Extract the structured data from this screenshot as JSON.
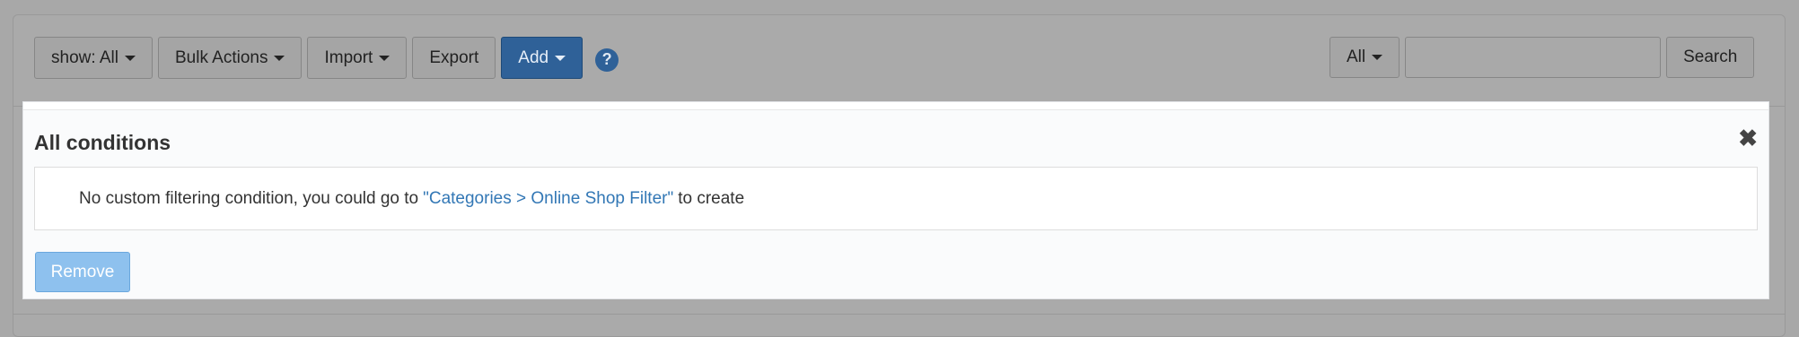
{
  "toolbar": {
    "show_label": "show: All",
    "bulk_actions_label": "Bulk Actions",
    "import_label": "Import",
    "export_label": "Export",
    "add_label": "Add",
    "help_glyph": "?"
  },
  "search": {
    "scope_label": "All",
    "value": "",
    "button_label": "Search"
  },
  "modal": {
    "title": "All conditions",
    "close_glyph": "✖",
    "message_prefix": "No custom filtering condition, you could go to",
    "message_link": "\"Categories > Online Shop Filter\"",
    "message_suffix": "to create",
    "remove_label": "Remove"
  },
  "colors": {
    "primary": "#2f6198",
    "link": "#3277b5",
    "remove_button": "#8ec1ee",
    "overlay": "#a8a8a8"
  }
}
